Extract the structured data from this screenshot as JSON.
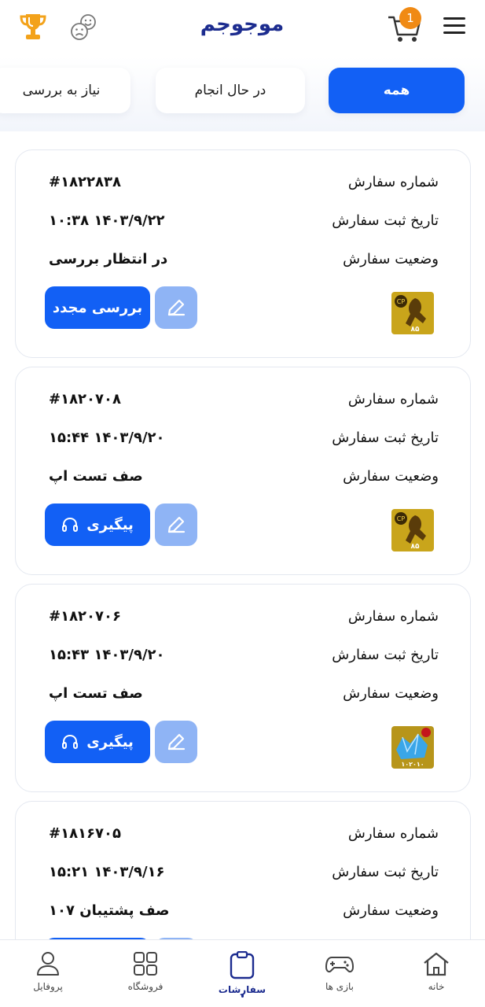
{
  "header": {
    "logo_text": "موجوجم",
    "cart_count": "1",
    "icons": [
      "trophy-icon",
      "sad-happy-face-icon",
      "cart-icon",
      "hamburger-menu-icon"
    ]
  },
  "tabs": [
    {
      "label": "همه",
      "active": true
    },
    {
      "label": "در حال انجام",
      "active": false
    },
    {
      "label": "نیاز به بررسی",
      "active": false
    }
  ],
  "labels": {
    "order_number": "شماره سفارش",
    "order_date": "تاریخ ثبت سفارش",
    "order_status": "وضعیت سفارش"
  },
  "orders": [
    {
      "number": "#۱۸۲۲۸۳۸",
      "date": "۱۴۰۳/۹/۲۲ ۱۰:۳۸",
      "status": "در انتظار بررسی",
      "action": "بررسی مجدد",
      "thumb": "soldier-game-icon"
    },
    {
      "number": "#۱۸۲۰۷۰۸",
      "date": "۱۴۰۳/۹/۲۰ ۱۵:۴۴",
      "status": "صف تست اپ",
      "action": "پیگیری",
      "thumb": "soldier-game-icon"
    },
    {
      "number": "#۱۸۲۰۷۰۶",
      "date": "۱۴۰۳/۹/۲۰ ۱۵:۴۳",
      "status": "صف تست اپ",
      "action": "پیگیری",
      "thumb": "gems-pack-icon"
    },
    {
      "number": "#۱۸۱۶۷۰۵",
      "date": "۱۴۰۳/۹/۱۶ ۱۵:۲۱",
      "status": "صف پشتیبان ۱۰۷",
      "action": "",
      "thumb": ""
    }
  ],
  "thumb_text": {
    "cp": "CP",
    "soldier_amount": "۸۵",
    "gems_amount": "۱۰۲۰۱۰"
  },
  "bottom_nav": [
    {
      "label": "خانه",
      "icon": "home-icon"
    },
    {
      "label": "بازی ها",
      "icon": "gamepad-icon"
    },
    {
      "label": "سفارشات",
      "icon": "orders-clipboard-icon",
      "active": true
    },
    {
      "label": "فروشگاه",
      "icon": "grid-store-icon"
    },
    {
      "label": "پروفایل",
      "icon": "user-icon"
    }
  ],
  "colors": {
    "primary": "#1260f5",
    "primary_light": "#8fb4f5",
    "brand_navy": "#1c2c8f",
    "accent_orange": "#f08a14"
  }
}
